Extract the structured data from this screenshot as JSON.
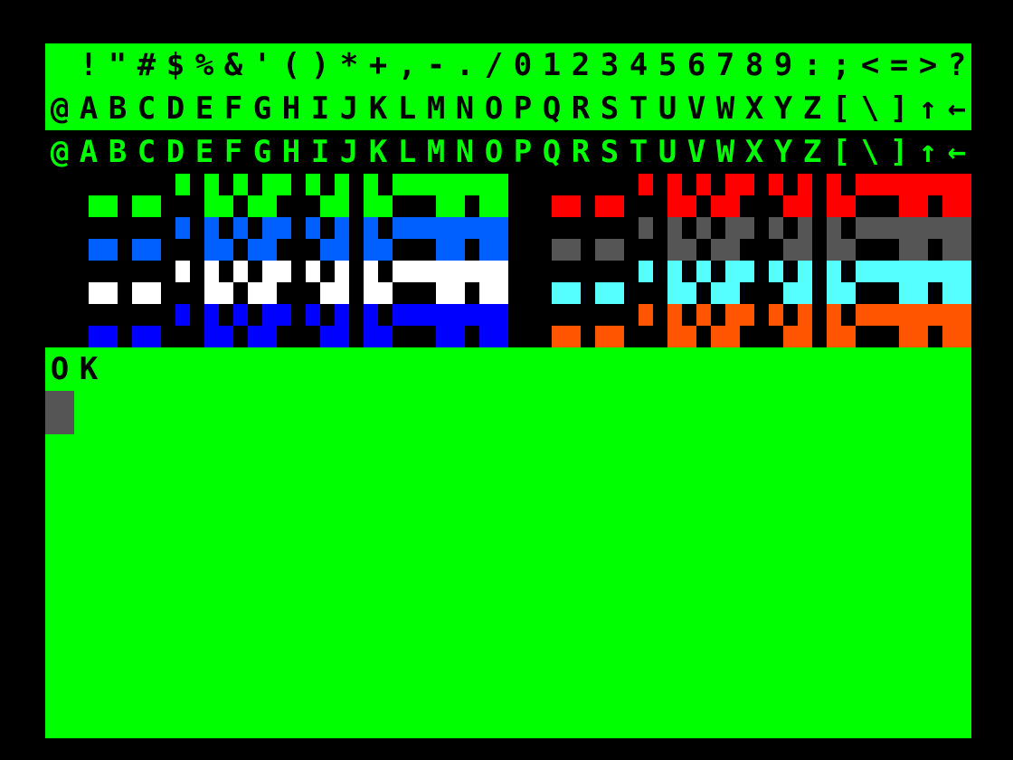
{
  "screen": {
    "rows": [
      {
        "text": " !\"#$%&'()*+,-./0123456789:;<=>?",
        "style": "inverse"
      },
      {
        "text": "@ABCDEFGHIJKLMNOPQRSTUVWXYZ[\\]↑←",
        "style": "inverse"
      },
      {
        "text": "@ABCDEFGHIJKLMNOPQRSTUVWXYZ[\\]↑←",
        "style": "normal"
      }
    ],
    "graphics_colors": {
      "left": [
        "#00ff00",
        "#0060ff",
        "#ffffff",
        "#0000ff"
      ],
      "right": [
        "#ff0000",
        "#555555",
        "#55ffff",
        "#ff5500"
      ]
    },
    "prompt": "OK",
    "cursor_color": "#555555"
  }
}
